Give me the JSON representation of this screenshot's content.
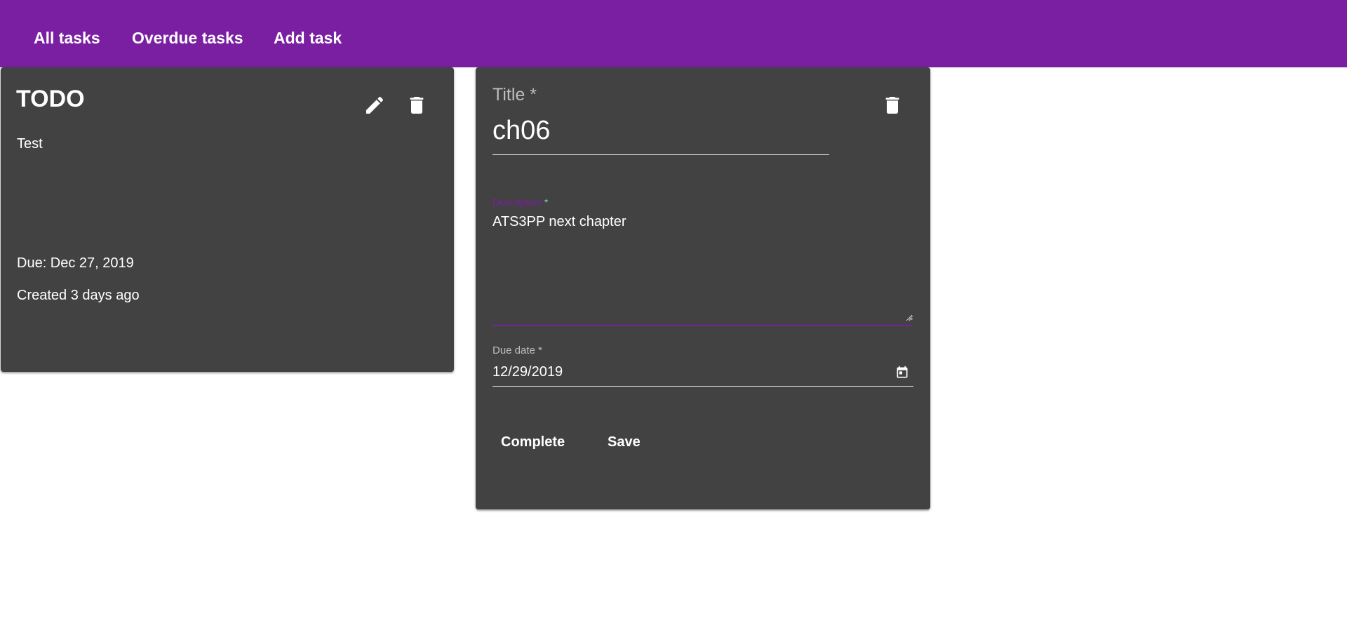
{
  "nav": {
    "all_tasks": "All tasks",
    "overdue_tasks": "Overdue tasks",
    "add_task": "Add task"
  },
  "task_card": {
    "title": "TODO",
    "description": "Test",
    "due": "Due: Dec 27, 2019",
    "created": "Created 3 days ago",
    "edit_icon": "pencil-icon",
    "delete_icon": "trash-icon"
  },
  "edit_form": {
    "title_label": "Title *",
    "title_value": "ch06",
    "description_label": "Description",
    "description_required": "*",
    "description_value": "ATS3PP next chapter",
    "due_label": "Due date *",
    "due_value": "12/29/2019",
    "calendar_icon": "calendar-icon",
    "delete_icon": "trash-icon",
    "complete_label": "Complete",
    "save_label": "Save"
  },
  "colors": {
    "primary": "#7b1fa2",
    "card_bg": "#424242",
    "accent": "#80cbc4"
  }
}
